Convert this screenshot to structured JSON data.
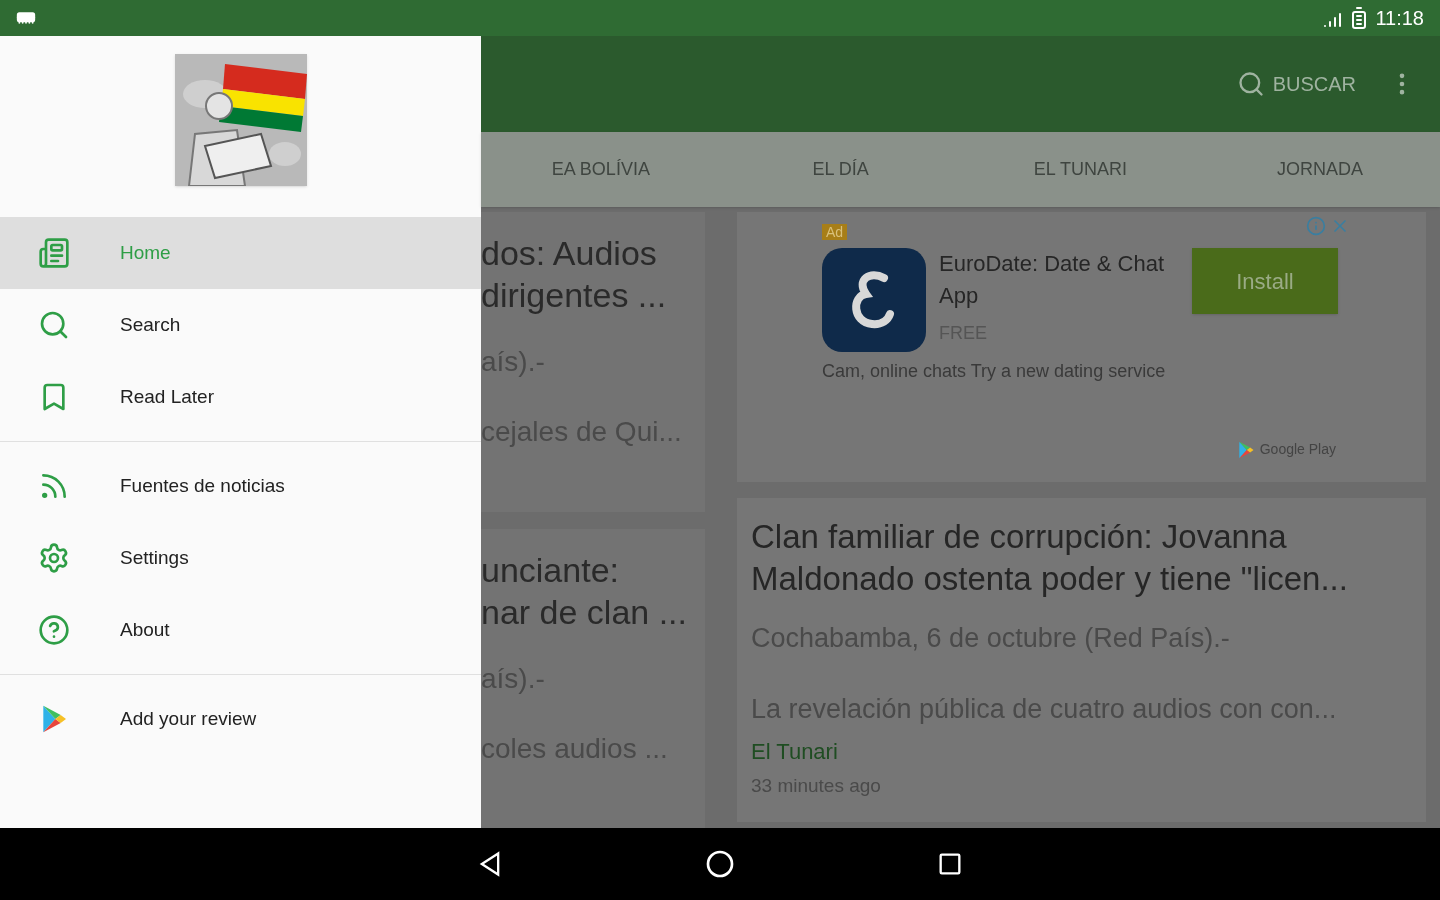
{
  "status_bar": {
    "time": "11:18"
  },
  "app_bar": {
    "search_label": "BUSCAR"
  },
  "tabs": [
    {
      "label": "EA BOLÍVIA"
    },
    {
      "label": "EL DÍA"
    },
    {
      "label": "EL TUNARI"
    },
    {
      "label": "JORNADA"
    }
  ],
  "left_cards": [
    {
      "title_lines": [
        "dos: Audios",
        "dirigentes ..."
      ],
      "lines": [
        "aís).-",
        "cejales de Qui..."
      ]
    },
    {
      "title_lines": [
        "unciante:",
        "nar de clan ..."
      ],
      "lines": [
        "aís).-",
        "coles audios ..."
      ]
    }
  ],
  "ad": {
    "badge": "Ad",
    "app_name": "EuroDate: Date & Chat App",
    "price": "FREE",
    "button": "Install",
    "description": "Cam, online chats Try a new dating service",
    "store": "Google Play"
  },
  "article": {
    "title": "Clan familiar de corrupción: Jovanna Maldonado ostenta poder y tiene \"licen...",
    "dateline": "Cochabamba, 6 de octubre (Red País).-",
    "snippet": "La revelación pública de cuatro audios con con...",
    "source": "El Tunari",
    "time": "33 minutes ago"
  },
  "drawer": {
    "sections": [
      {
        "items": [
          {
            "label": "Home",
            "selected": true
          },
          {
            "label": "Search",
            "selected": false
          },
          {
            "label": "Read Later",
            "selected": false
          }
        ]
      },
      {
        "items": [
          {
            "label": "Fuentes de noticias",
            "selected": false
          },
          {
            "label": "Settings",
            "selected": false
          },
          {
            "label": "About",
            "selected": false
          }
        ]
      },
      {
        "items": [
          {
            "label": "Add your review",
            "selected": false
          }
        ]
      }
    ]
  }
}
